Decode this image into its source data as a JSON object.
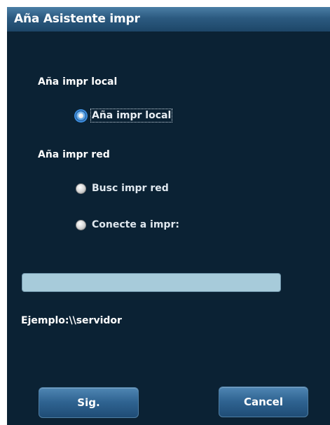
{
  "dialog": {
    "title": "Aña Asistente impr"
  },
  "local_printer": {
    "section_label": "Aña impr local",
    "option_label": "Aña impr local"
  },
  "network_printer": {
    "section_label": "Aña impr red",
    "search_label": "Busc impr red",
    "connect_label": "Conecte a impr:"
  },
  "printer_address": {
    "value": ""
  },
  "example": {
    "text": "Ejemplo:\\\\servidor"
  },
  "buttons": {
    "next": "Sig.",
    "cancel": "Cancel"
  },
  "colors": {
    "background": "#0b2234",
    "title_bar": "#2c5a80",
    "field": "#a7cbda",
    "button": "#2f6391"
  }
}
